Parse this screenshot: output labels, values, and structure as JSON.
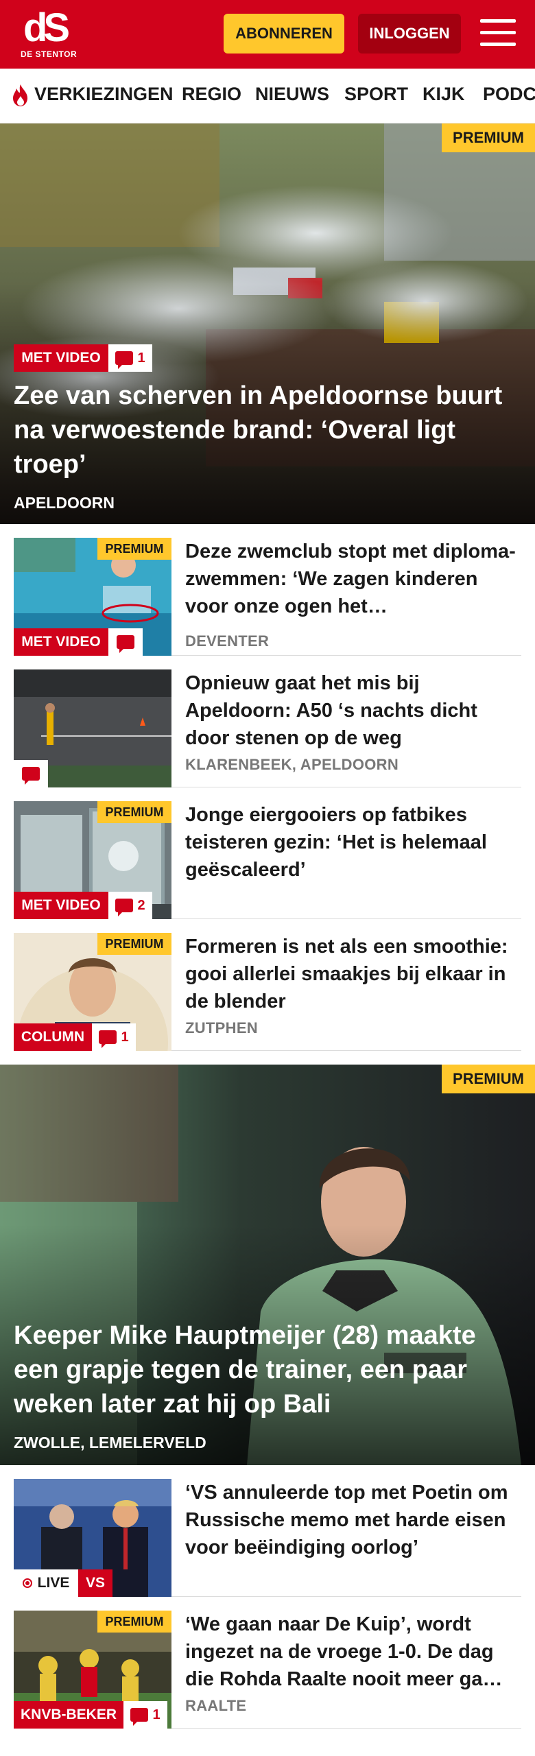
{
  "header": {
    "logo_mark": "dS",
    "logo_sub": "DE STENTOR",
    "subscribe_label": "ABONNEREN",
    "login_label": "INLOGGEN"
  },
  "nav": {
    "items": [
      "VERKIEZINGEN",
      "REGIO",
      "NIEUWS",
      "SPORT",
      "KIJK",
      "PODC"
    ]
  },
  "hero1": {
    "badge": "PREMIUM",
    "tag": "MET VIDEO",
    "comments": "1",
    "headline": "Zee van scherven in Apeldoornse buurt na verwoestende brand: ‘Overal ligt troep’",
    "location": "APELDOORN"
  },
  "list1": [
    {
      "badge": "PREMIUM",
      "tag": "MET VIDEO",
      "comments": "",
      "title": "Deze zwemclub stopt met diploma-zwemmen: ‘We zagen kinderen voor onze ogen het…",
      "location": "DEVENTER"
    },
    {
      "badge": "",
      "tag": "",
      "comments": "",
      "title": "Opnieuw gaat het mis bij Apeldoorn: A50 ‘s nachts dicht door stenen op de weg",
      "location": "KLARENBEEK, APELDOORN"
    },
    {
      "badge": "PREMIUM",
      "tag": "MET VIDEO",
      "comments": "2",
      "title": "Jonge eiergooiers op fatbikes teisteren gezin: ‘Het is helemaal geëscaleerd’",
      "location": ""
    },
    {
      "badge": "PREMIUM",
      "tag": "COLUMN",
      "comments": "1",
      "title": "Formeren is net als een smoothie: gooi allerlei smaakjes bij elkaar in de blender",
      "location": "ZUTPHEN"
    }
  ],
  "hero2": {
    "badge": "PREMIUM",
    "headline": "Keeper Mike Hauptmeijer (28) maakte een grapje tegen de trainer, een paar weken later zat hij op Bali",
    "location": "ZWOLLE, LEMELERVELD"
  },
  "list2": [
    {
      "live": "LIVE",
      "tag": "VS",
      "title": "‘VS annuleerde top met Poetin om Russische memo met harde eisen voor beëindiging oorlog’"
    },
    {
      "badge": "PREMIUM",
      "tag": "KNVB-BEKER",
      "comments": "1",
      "title": "‘We gaan naar De Kuip’, wordt ingezet na de vroege 1-0. De dag die Rohda Raalte nooit meer ga…",
      "location": "RAALTE"
    }
  ],
  "colors": {
    "brand_red": "#d0021b",
    "premium_yellow": "#ffc72c",
    "login_dark_red": "#a30010"
  }
}
